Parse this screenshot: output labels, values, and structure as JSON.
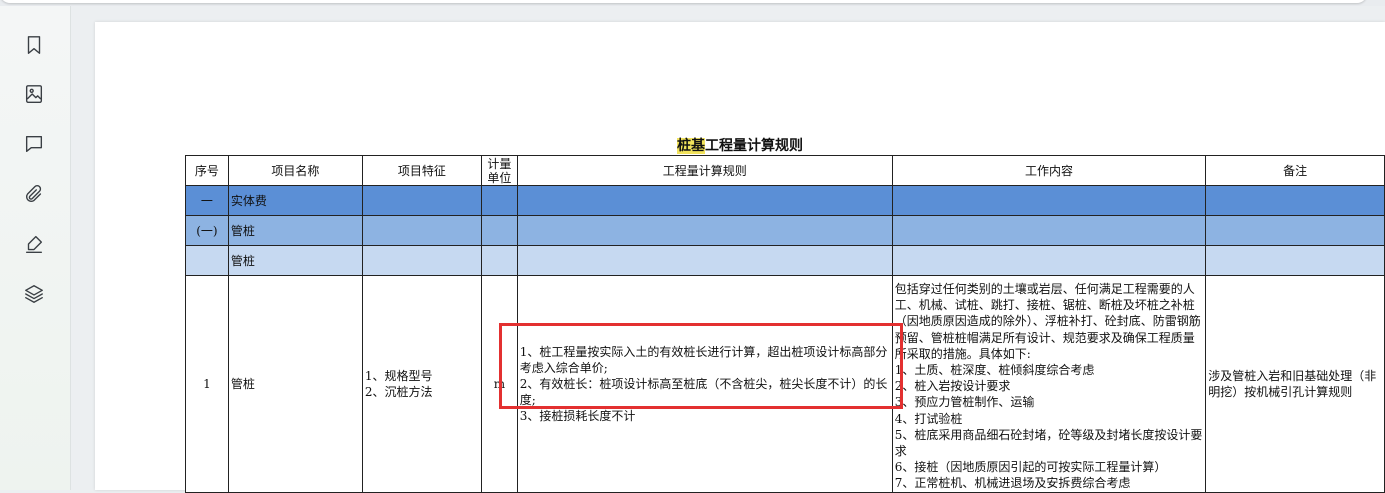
{
  "sidebar": {
    "items": [
      {
        "icon": "bookmark-icon"
      },
      {
        "icon": "image-icon"
      },
      {
        "icon": "comment-icon"
      },
      {
        "icon": "attachment-icon"
      },
      {
        "icon": "sign-pen-icon"
      },
      {
        "icon": "layers-icon"
      }
    ]
  },
  "document": {
    "title_highlight": "桩基",
    "title_rest": "工程量计算规则",
    "highlight_color": "#f2e35c",
    "headers": {
      "no": "序号",
      "name": "项目名称",
      "feature": "项目特征",
      "unit_line1": "计量",
      "unit_line2": "单位",
      "rule": "工程量计算规则",
      "work": "工作内容",
      "note": "备注"
    },
    "rows": {
      "r1": {
        "no": "一",
        "name": "实体费",
        "color": "#5b8fd6"
      },
      "r2": {
        "no": "(一)",
        "name": "管桩",
        "color": "#8db3e2"
      },
      "r3": {
        "no": "",
        "name": "管桩",
        "color": "#c6d9f1"
      },
      "main": {
        "no": "1",
        "name": "管桩",
        "feature_1": "1、规格型号",
        "feature_2": "2、沉桩方法",
        "unit": "m",
        "rule_1": "1、桩工程量按实际入土的有效桩长进行计算，超出桩项设计标高部分考虑入综合单价;",
        "rule_2": "2、有效桩长：桩项设计标高至桩底（不含桩尖，桩尖长度不计）的长度;",
        "rule_3": "3、接桩损耗长度不计",
        "work_intro": "包括穿过任何类别的土壤或岩层、任何满足工程需要的人工、机械、试桩、跳打、接桩、锯桩、断桩及坏桩之补桩（因地质原因造成的除外）、浮桩补打、砼封底、防雷钢筋预留、管桩桩帽满足所有设计、规范要求及确保工程质量所采取的措施。具体如下:",
        "work_1": "1、土质、桩深度、桩倾斜度综合考虑",
        "work_2": "2、桩入岩按设计要求",
        "work_3": "3、预应力管桩制作、运输",
        "work_4": "4、打试验桩",
        "work_5": "5、桩底采用商品细石砼封堵，砼等级及封堵长度按设计要求",
        "work_6": "6、接桩（因地质原因引起的可按实际工程量计算）",
        "work_7": "7、正常桩机、机械进退场及安拆费综合考虑",
        "note": "涉及管桩入岩和旧基础处理（非明挖）按机械引孔计算规则"
      }
    },
    "annotation_color": "#e33030"
  }
}
